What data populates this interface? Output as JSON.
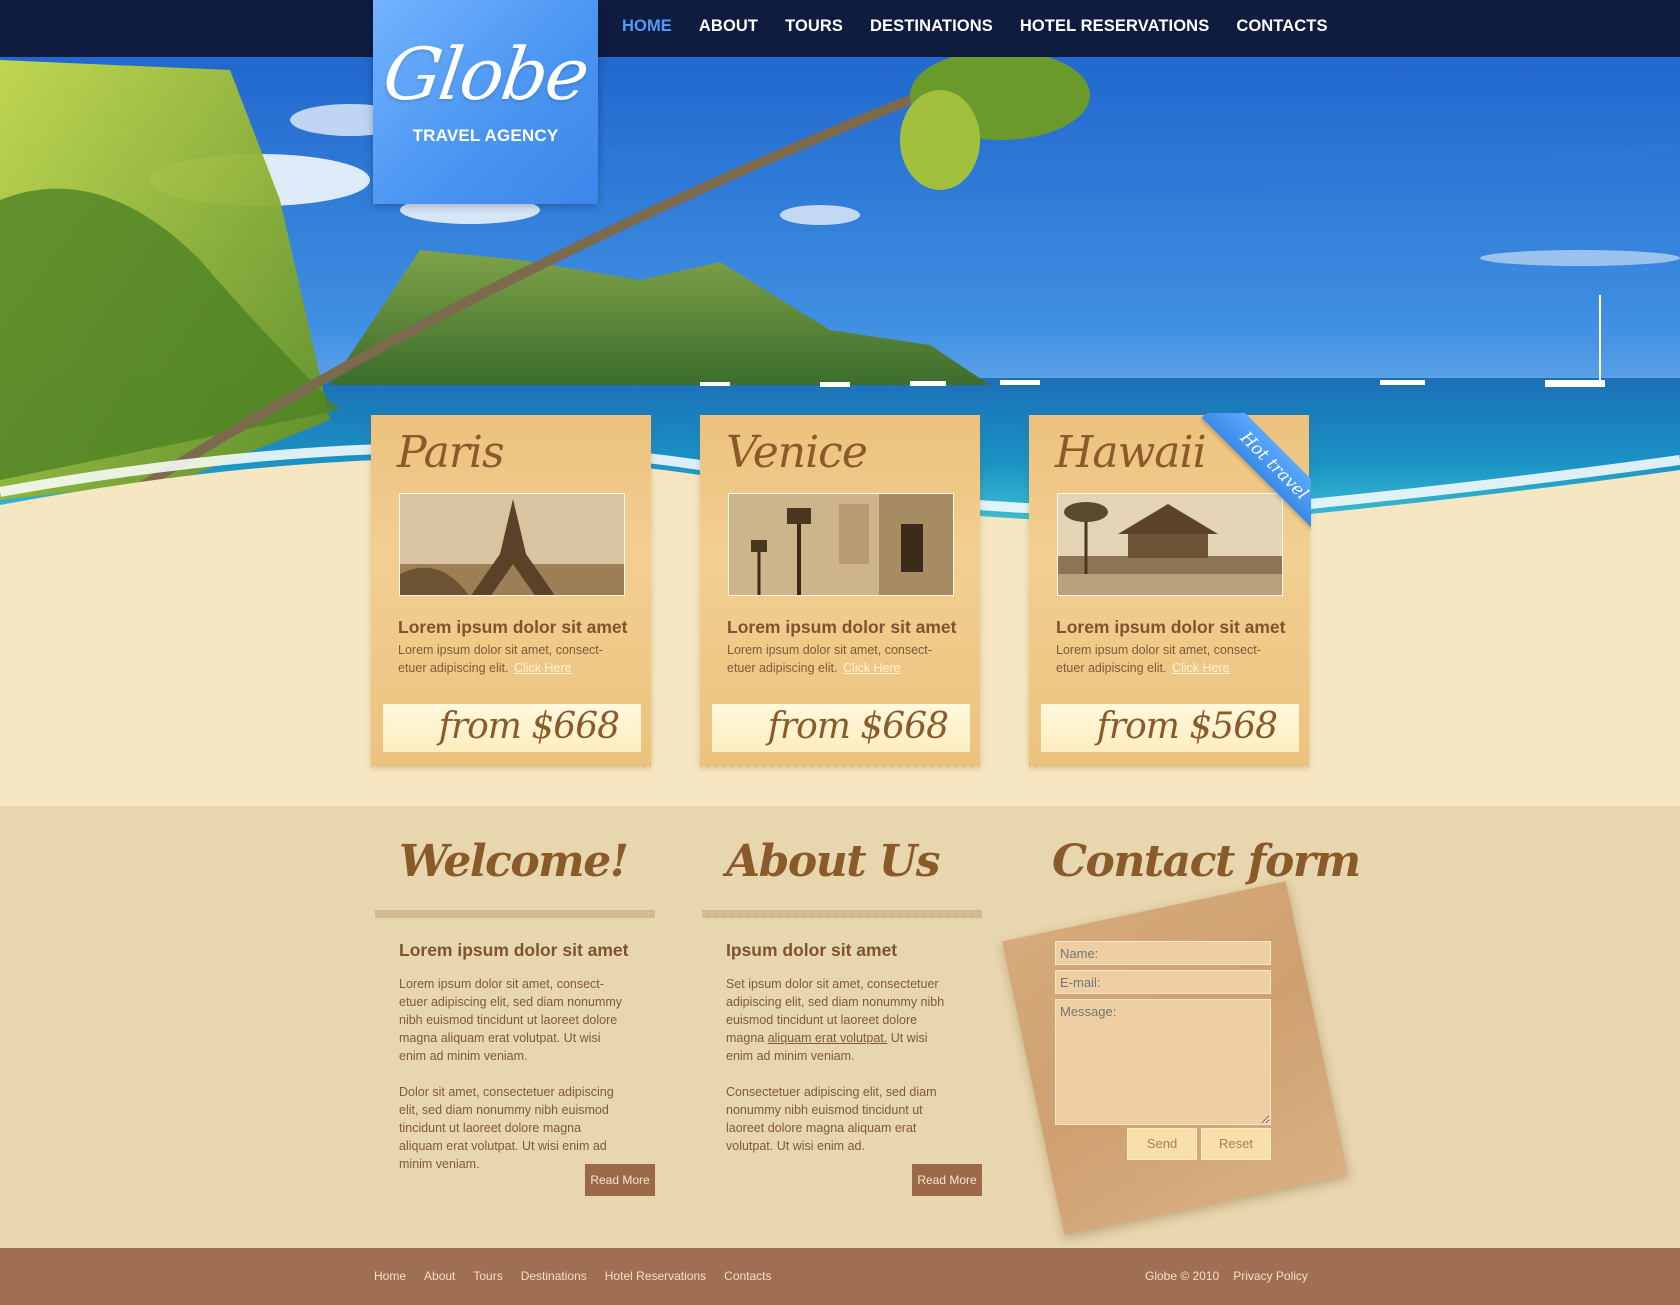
{
  "brand": {
    "logo_text": "Globe",
    "tagline": "TRAVEL AGENCY"
  },
  "nav": [
    {
      "label": "HOME",
      "active": true
    },
    {
      "label": "ABOUT",
      "active": false
    },
    {
      "label": "TOURS",
      "active": false
    },
    {
      "label": "DESTINATIONS",
      "active": false
    },
    {
      "label": "HOTEL RESERVATIONS",
      "active": false
    },
    {
      "label": "CONTACTS",
      "active": false
    }
  ],
  "cards": [
    {
      "title": "Paris",
      "heading": "Lorem ipsum dolor sit amet",
      "text": "Lorem ipsum dolor sit amet, consect-etuer adipiscing elit.",
      "link": "Click Here",
      "price": "from $668"
    },
    {
      "title": "Venice",
      "heading": "Lorem ipsum dolor sit amet",
      "text": "Lorem ipsum dolor sit amet, consect-etuer adipiscing elit.",
      "link": "Click Here",
      "price": "from $668"
    },
    {
      "title": "Hawaii",
      "heading": "Lorem ipsum dolor sit amet",
      "text": "Lorem ipsum dolor sit amet, consect-etuer adipiscing elit.",
      "link": "Click Here",
      "price": "from $568",
      "ribbon": "Hot travel"
    }
  ],
  "welcome": {
    "title": "Welcome!",
    "heading": "Lorem ipsum dolor sit amet",
    "p1": "Lorem ipsum dolor sit amet, consect-etuer adipiscing elit, sed diam nonummy nibh euismod tincidunt ut laoreet dolore magna aliquam erat volutpat. Ut wisi enim ad minim veniam.",
    "p2": "Dolor sit amet, consectetuer adipiscing elit, sed diam nonummy nibh euismod tincidunt ut laoreet dolore magna aliquam erat volutpat. Ut wisi enim ad minim veniam.",
    "button": "Read More"
  },
  "about": {
    "title": "About Us",
    "heading": "Ipsum dolor sit amet",
    "p1_before": "Set ipsum dolor sit amet, consectetuer adipiscing elit, sed diam nonummy nibh euismod tincidunt ut laoreet dolore magna ",
    "p1_link": "aliquam erat volutpat.",
    "p1_after": " Ut wisi enim ad minim veniam.",
    "p2": "Consectetuer adipiscing elit, sed diam nonummy nibh euismod tincidunt ut laoreet dolore magna aliquam erat volutpat. Ut wisi enim ad.",
    "button": "Read More"
  },
  "contact": {
    "title": "Contact form",
    "name_placeholder": "Name:",
    "email_placeholder": "E-mail:",
    "message_placeholder": "Message:",
    "send": "Send",
    "reset": "Reset"
  },
  "footer": {
    "links": [
      "Home",
      "About",
      "Tours",
      "Destinations",
      "Hotel Reservations",
      "Contacts"
    ],
    "copyright": "Globe © 2010",
    "privacy": "Privacy Policy"
  },
  "colors": {
    "topbar": "#0f1c40",
    "accent": "#4f9bf5",
    "card": "#ecc17d",
    "text_brown": "#8b5a2b",
    "footer": "#a06e52"
  }
}
